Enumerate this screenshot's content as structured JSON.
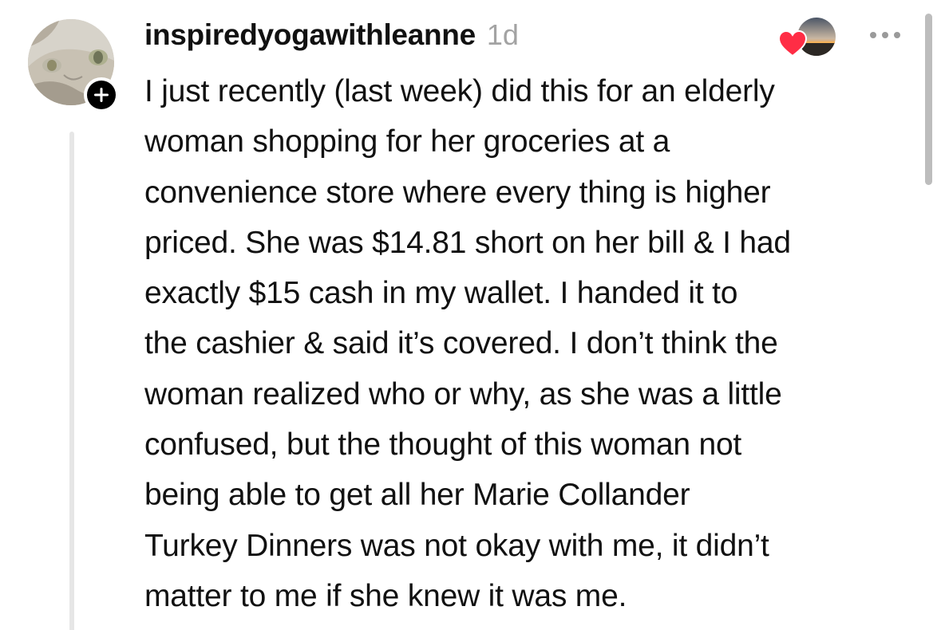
{
  "comment": {
    "username": "inspiredyogawithleanne",
    "timestamp": "1d",
    "body_lines": [
      "I just recently (last week) did this for an elderly",
      "woman shopping for her groceries at a",
      "convenience store where every thing is higher",
      "priced. She was $14.81 short on her bill & I had",
      "exactly $15 cash in my wallet. I handed it to",
      "the cashier & said it’s covered. I don’t think the",
      "woman realized who or why, as she was a little",
      "confused, but the thought of this woman not",
      "being able to get all her Marie Collander",
      "Turkey Dinners was not okay with me, it didn’t",
      "matter to me if she knew it was me."
    ]
  },
  "icons": {
    "follow": "plus-icon",
    "liked_by": "heart-icon",
    "more": "ellipsis-icon"
  },
  "colors": {
    "text": "#111111",
    "timestamp": "#a3a3a3",
    "heart": "#ff2d45",
    "badge": "#000000",
    "thread_line": "#e6e6e6",
    "scrollbar": "#bdbdbd"
  }
}
